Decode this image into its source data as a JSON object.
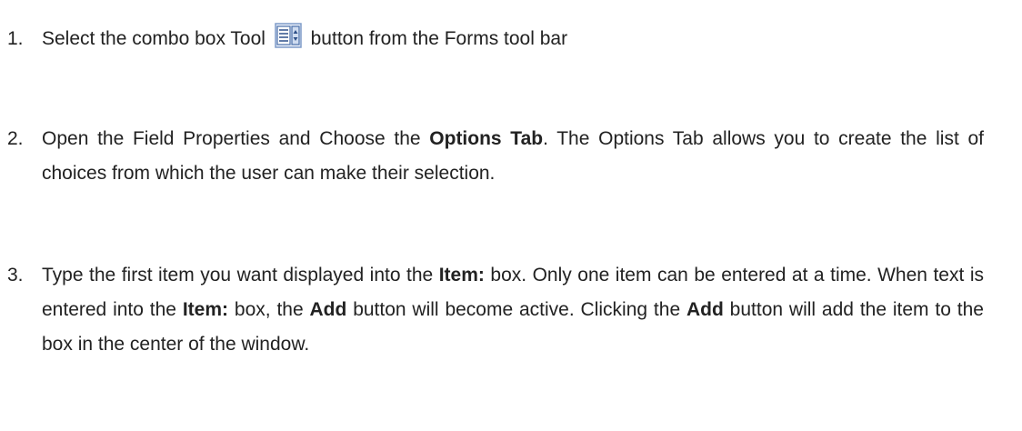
{
  "steps": [
    {
      "number": "1.",
      "parts": {
        "a": "Select the combo box Tool",
        "icon": "combo-box-tool-icon",
        "b": "button from the Forms tool bar"
      }
    },
    {
      "number": "2.",
      "parts": {
        "a": "Open the Field Properties and Choose the",
        "bold1": "Options Tab",
        "b": ". The Options Tab allows you to create the list of choices from which the user can make their selection."
      }
    },
    {
      "number": "3.",
      "parts": {
        "a": "Type the first item you want displayed into the",
        "bold1": "Item:",
        "b": "box. Only one item can be entered at a time. When text is entered into the",
        "bold2": "Item:",
        "c": "box, the",
        "bold3": "Add",
        "d": "button will become active. Clicking the",
        "bold4": "Add",
        "e": "button will add the item to the box in the center of the window."
      }
    }
  ],
  "colors": {
    "text": "#222222",
    "icon_border": "#5a7fb8",
    "icon_fill": "#dfe9f7"
  }
}
